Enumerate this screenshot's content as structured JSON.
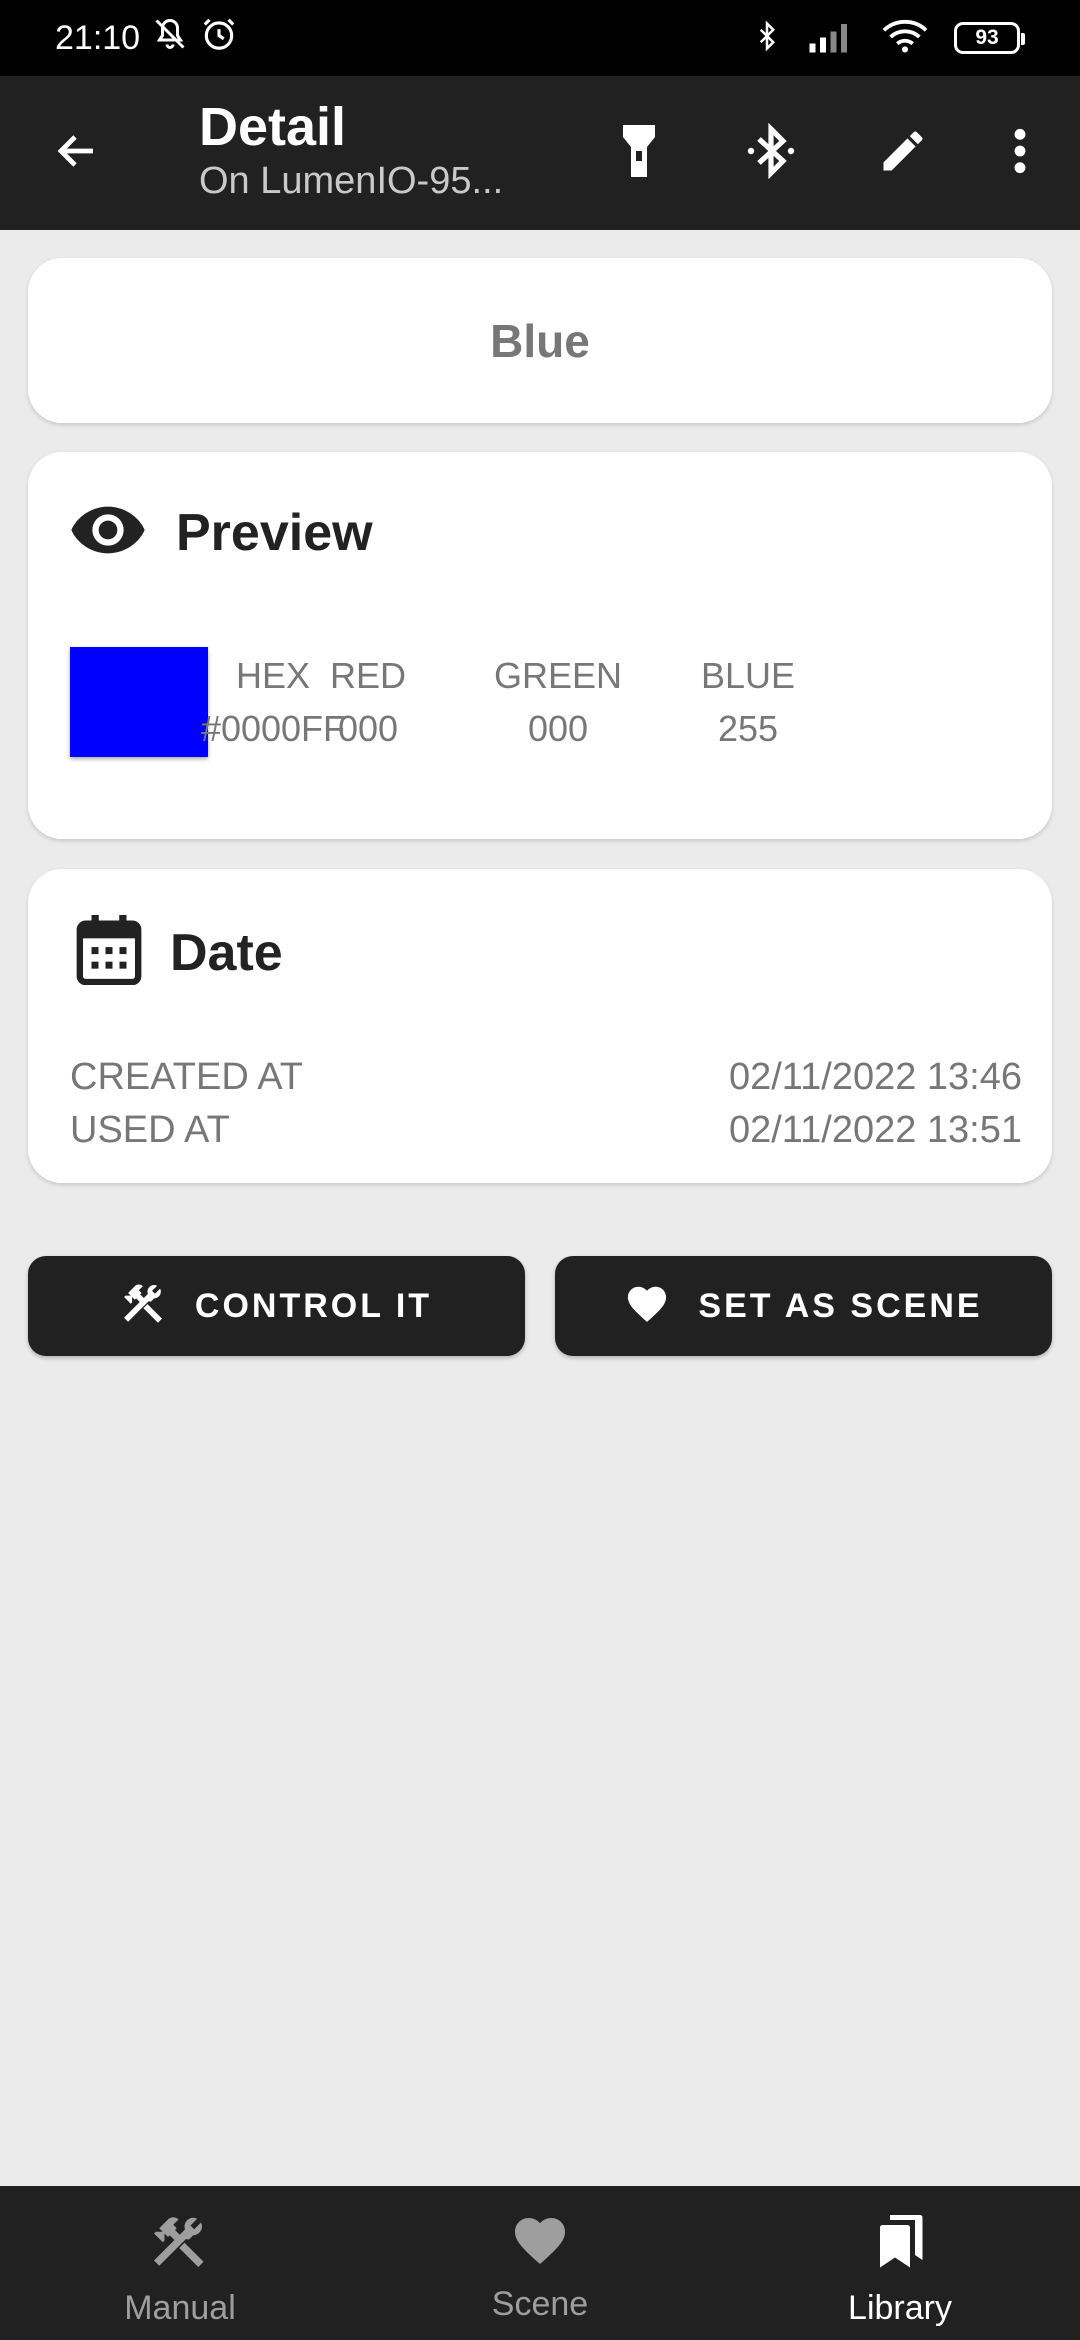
{
  "status_bar": {
    "time": "21:10",
    "battery": "93",
    "icons": [
      "mute-icon",
      "alarm-icon",
      "bluetooth-icon",
      "signal-icon",
      "wifi-icon",
      "battery-icon"
    ]
  },
  "app_bar": {
    "title": "Detail",
    "subtitle": "On LumenIO-95...",
    "actions": [
      "back-icon",
      "flashlight-icon",
      "bluetooth-icon",
      "edit-icon",
      "more-icon"
    ]
  },
  "name_card": {
    "name": "Blue"
  },
  "preview": {
    "title": "Preview",
    "swatch_color": "#0000FF",
    "columns": [
      {
        "label": "HEX",
        "value": "#0000FF"
      },
      {
        "label": "RED",
        "value": "000"
      },
      {
        "label": "GREEN",
        "value": "000"
      },
      {
        "label": "BLUE",
        "value": "255"
      }
    ]
  },
  "date": {
    "title": "Date",
    "rows": [
      {
        "label": "CREATED AT",
        "value": "02/11/2022 13:46"
      },
      {
        "label": "USED AT",
        "value": "02/11/2022 13:51"
      }
    ]
  },
  "actions": {
    "control_label": "CONTROL IT",
    "scene_label": "SET AS SCENE"
  },
  "bottom_nav": {
    "items": [
      {
        "label": "Manual",
        "icon": "tools-icon"
      },
      {
        "label": "Scene",
        "icon": "heart-icon"
      },
      {
        "label": "Library",
        "icon": "library-icon"
      }
    ],
    "active": "Library"
  }
}
